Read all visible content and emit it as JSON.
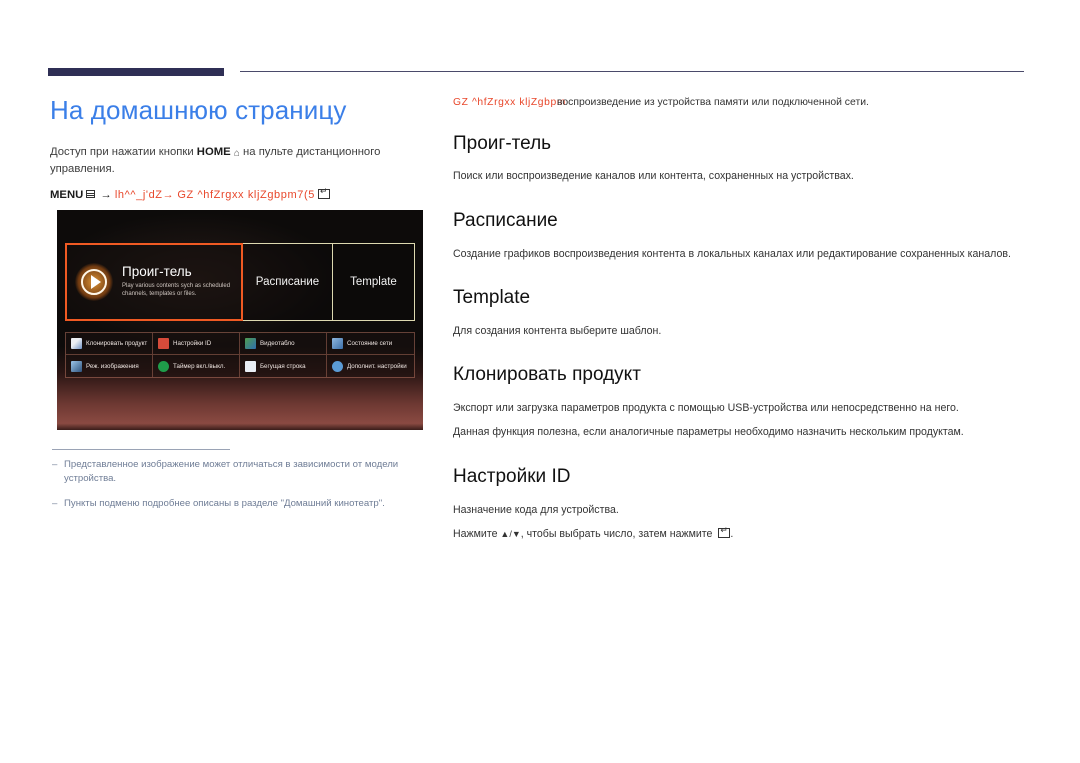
{
  "page": {
    "title": "На домашнюю страницу",
    "title_color": "#3b7fe8",
    "accent_color": "#2f2f55",
    "garble_color": "#e8472b"
  },
  "left": {
    "intro_prefix": "Доступ при нажатии кнопки ",
    "intro_bold": "HOME",
    "home_icon": "home-icon",
    "intro_suffix": " на пульте дистанционного управления.",
    "menu_label": "MENU",
    "menu_grid_icon": "menu-grid-icon",
    "menu_arrow": "→",
    "menu_garbled_1": "lh^^_j'dZ",
    "menu_garbled_arrow": "→",
    "menu_garbled_2": "GZ ^hfZrgxx kljZgbpm7(5",
    "enter_icon": "enter-key-icon"
  },
  "device": {
    "top_tiles": [
      {
        "id": "player",
        "title": "Проиг-тель",
        "subtitle": "Play various contents sych as scheduled channels, templates or files.",
        "selected": true,
        "icon": "play-circle-icon"
      },
      {
        "id": "schedule",
        "title": "Расписание",
        "selected": false
      },
      {
        "id": "template",
        "title": "Template",
        "selected": false
      }
    ],
    "grid_tiles": [
      {
        "label": "Клонировать продукт",
        "icon": "clone-product-icon"
      },
      {
        "label": "Настройки ID",
        "icon": "id-settings-icon"
      },
      {
        "label": "Видеотабло",
        "icon": "video-wall-icon"
      },
      {
        "label": "Состояние сети",
        "icon": "network-status-icon"
      },
      {
        "label": "Реж. изображения",
        "icon": "picture-mode-icon"
      },
      {
        "label": "Таймер вкл./выкл.",
        "icon": "on-off-timer-icon"
      },
      {
        "label": "Бегущая строка",
        "icon": "ticker-icon"
      },
      {
        "label": "Дополнит. настройки",
        "icon": "advanced-settings-icon"
      }
    ]
  },
  "footnotes": [
    {
      "dash": "‒",
      "text": "Представленное изображение может отличаться в зависимости от модели устройства."
    },
    {
      "dash": "‒",
      "text": "Пункты подменю подробнее описаны в разделе \"Домашний кинотеатр\"."
    }
  ],
  "right": {
    "note_garbled": "GZ ^hfZrgxx kljZgbpm",
    "note_text": "воспроизведение из устройства памяти или подключенной сети.",
    "sections": [
      {
        "heading": "Проиг-тель",
        "paragraphs": [
          "Поиск или воспроизведение каналов или контента, сохраненных на устройствах."
        ]
      },
      {
        "heading": "Расписание",
        "paragraphs": [
          "Создание графиков воспроизведения контента в локальных каналах или редактирование сохраненных каналов."
        ]
      },
      {
        "heading": "Template",
        "paragraphs": [
          "Для создания контента выберите шаблон."
        ]
      },
      {
        "heading": "Клонировать продукт",
        "paragraphs": [
          "Экспорт или загрузка параметров продукта с помощью USB-устройства или непосредственно на него.",
          "Данная функция полезна, если аналогичные параметры необходимо назначить нескольким продуктам."
        ]
      },
      {
        "heading": "Настройки ID",
        "paragraphs": [
          "Назначение кода для устройства."
        ],
        "last_line_prefix": "Нажмите ",
        "last_line_arrows": "▲/▼",
        "last_line_mid": ", чтобы выбрать число, затем нажмите ",
        "last_line_suffix": ".",
        "enter_icon": "enter-key-icon"
      }
    ]
  }
}
